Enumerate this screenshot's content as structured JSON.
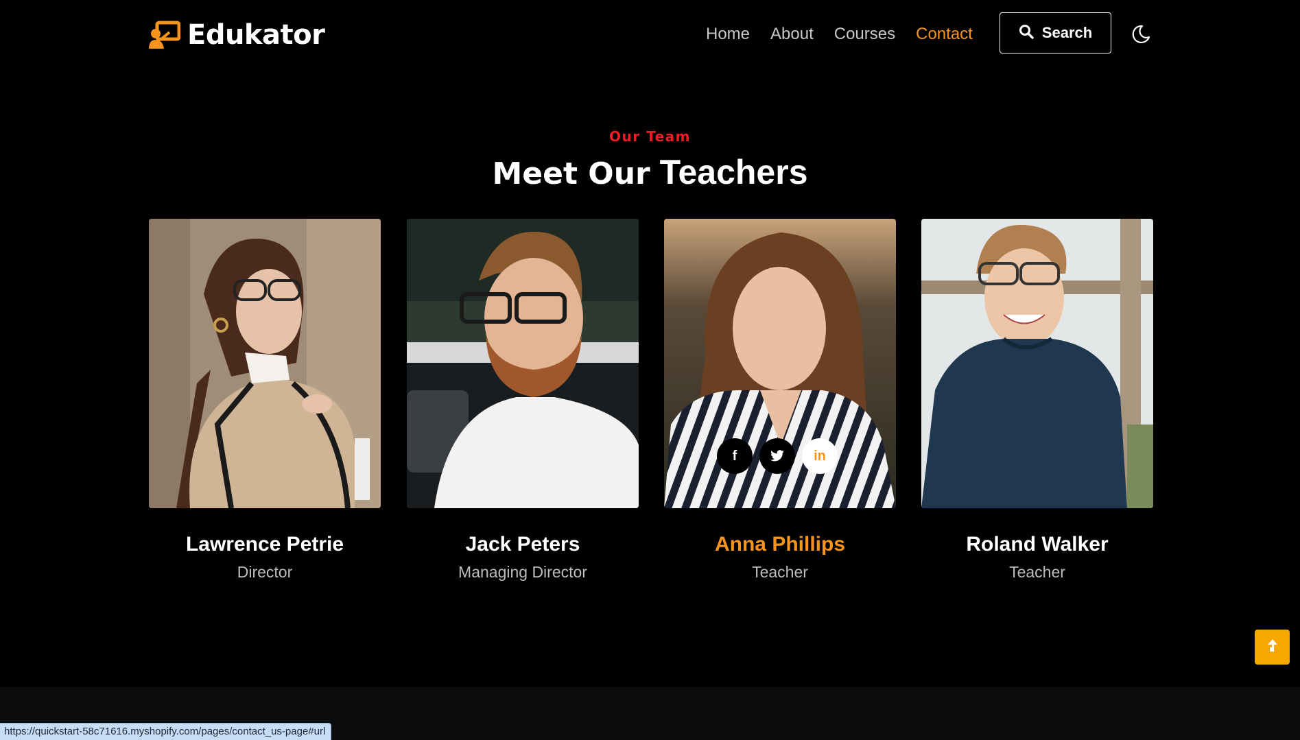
{
  "brand": {
    "name": "Edukator",
    "logo_icon": "teacher-board-icon",
    "accent": "#f7941d"
  },
  "nav": {
    "items": [
      {
        "label": "Home"
      },
      {
        "label": "About"
      },
      {
        "label": "Courses"
      },
      {
        "label": "Contact",
        "active": true
      }
    ],
    "search_label": "Search",
    "search_icon": "search-icon",
    "theme_icon": "moon-icon"
  },
  "section": {
    "eyebrow": "Our Team",
    "title_bold": "Meet Our",
    "title_light": "Teachers",
    "eyebrow_color": "#ee1c25"
  },
  "teachers": [
    {
      "name": "Lawrence Petrie",
      "role": "Director"
    },
    {
      "name": "Jack Peters",
      "role": "Managing Director"
    },
    {
      "name": "Anna Phillips",
      "role": "Teacher",
      "hover": true,
      "socials": [
        {
          "icon": "facebook-icon",
          "glyph": "f"
        },
        {
          "icon": "twitter-icon",
          "glyph": "🐦"
        },
        {
          "icon": "linkedin-icon",
          "glyph": "in"
        }
      ]
    },
    {
      "name": "Roland Walker",
      "role": "Teacher"
    }
  ],
  "scroll_top_icon": "arrow-up-icon",
  "status_bar": {
    "url": "https://quickstart-58c71616.myshopify.com/pages/contact_us-page#url"
  }
}
